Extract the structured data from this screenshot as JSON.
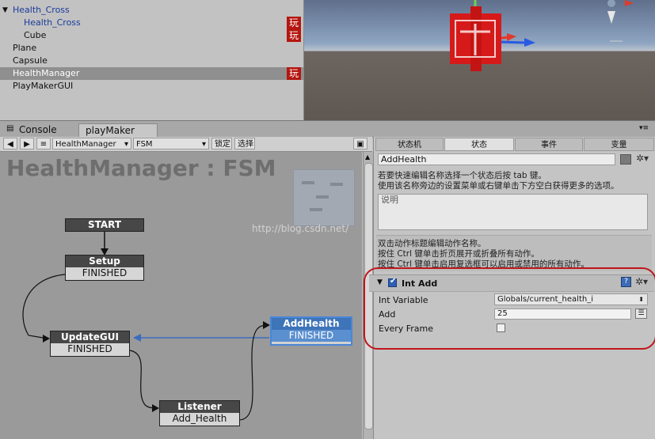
{
  "hierarchy": {
    "items": [
      {
        "label": "Health_Cross",
        "arrow": "▼",
        "blue": true,
        "wan": false
      },
      {
        "label": "Health_Cross",
        "arrow": "",
        "blue": true,
        "wan": true
      },
      {
        "label": "Cube",
        "arrow": "",
        "blue": false,
        "wan": true
      },
      {
        "label": "Plane",
        "arrow": "",
        "blue": false,
        "wan": false
      },
      {
        "label": "Capsule",
        "arrow": "",
        "blue": false,
        "wan": false
      },
      {
        "label": "HealthManager",
        "arrow": "",
        "blue": false,
        "wan": true
      },
      {
        "label": "PlayMakerGUI",
        "arrow": "",
        "blue": false,
        "wan": false
      }
    ],
    "badge": "玩"
  },
  "tabs": {
    "console": "Console",
    "playmaker": "playMaker"
  },
  "toolbar": {
    "fsm_owner": "HealthManager",
    "fsm_name": "FSM",
    "lock": "锁定",
    "select": "选择"
  },
  "graph": {
    "title": "HealthManager : FSM",
    "watermark": "http://blog.csdn.net/",
    "start_label": "START",
    "nodes": {
      "setup": {
        "name": "Setup",
        "transition": "FINISHED"
      },
      "updategui": {
        "name": "UpdateGUI",
        "transition": "FINISHED"
      },
      "addhealth": {
        "name": "AddHealth",
        "transition": "FINISHED"
      },
      "listener": {
        "name": "Listener",
        "transition": "Add_Health"
      }
    }
  },
  "inspector": {
    "tabs": [
      "状态机",
      "状态",
      "事件",
      "变量"
    ],
    "active_tab": "状态",
    "state_name": "AddHealth",
    "rename_hint_1": "若要快速编辑名称选择一个状态后按 tab 键。",
    "rename_hint_2": "使用该名称旁边的设置菜单或右键单击下方空白获得更多的选项。",
    "description_placeholder": "说明",
    "action_hint_1": "双击动作标题编辑动作名称。",
    "action_hint_2": "按住 Ctrl 键单击折页展开或折叠所有动作。",
    "action_hint_3": "按住 Ctrl 键单击启用复选框可以启用或禁用的所有动作。",
    "action": {
      "title": "Int Add",
      "enabled": true,
      "int_variable_label": "Int Variable",
      "int_variable_value": "Globals/current_health_i",
      "add_label": "Add",
      "add_value": "25",
      "every_frame_label": "Every Frame",
      "every_frame": false
    }
  },
  "colors": {
    "selected_node": "#4a86d6",
    "highlight_oval": "#c0161a",
    "badge": "#b5160f"
  }
}
